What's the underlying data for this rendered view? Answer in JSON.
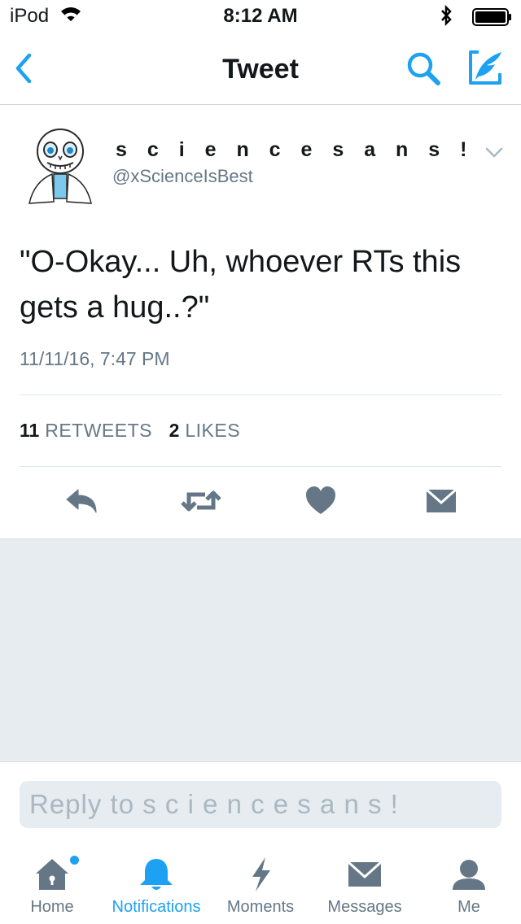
{
  "status_bar": {
    "carrier": "iPod",
    "time": "8:12 AM"
  },
  "nav": {
    "title": "Tweet"
  },
  "tweet": {
    "display_name": "s c i e n c e s a n s !",
    "handle": "@xScienceIsBest",
    "text": "\"O-Okay... Uh, whoever RTs this gets a hug..?\"",
    "timestamp": "11/11/16, 7:47 PM",
    "retweets_count": "11",
    "retweets_label": "RETWEETS",
    "likes_count": "2",
    "likes_label": "LIKES"
  },
  "reply": {
    "placeholder": "Reply to s c i e n c e s a n s !"
  },
  "tabs": [
    {
      "label": "Home",
      "icon": "home-icon",
      "active": false,
      "badge": true
    },
    {
      "label": "Notifications",
      "icon": "bell-icon",
      "active": true
    },
    {
      "label": "Moments",
      "icon": "lightning-icon",
      "active": false
    },
    {
      "label": "Messages",
      "icon": "envelope-icon",
      "active": false
    },
    {
      "label": "Me",
      "icon": "person-icon",
      "active": false
    }
  ],
  "colors": {
    "accent": "#1da1f2",
    "icon_gray": "#657786",
    "background_gray": "#e6ecf0"
  }
}
